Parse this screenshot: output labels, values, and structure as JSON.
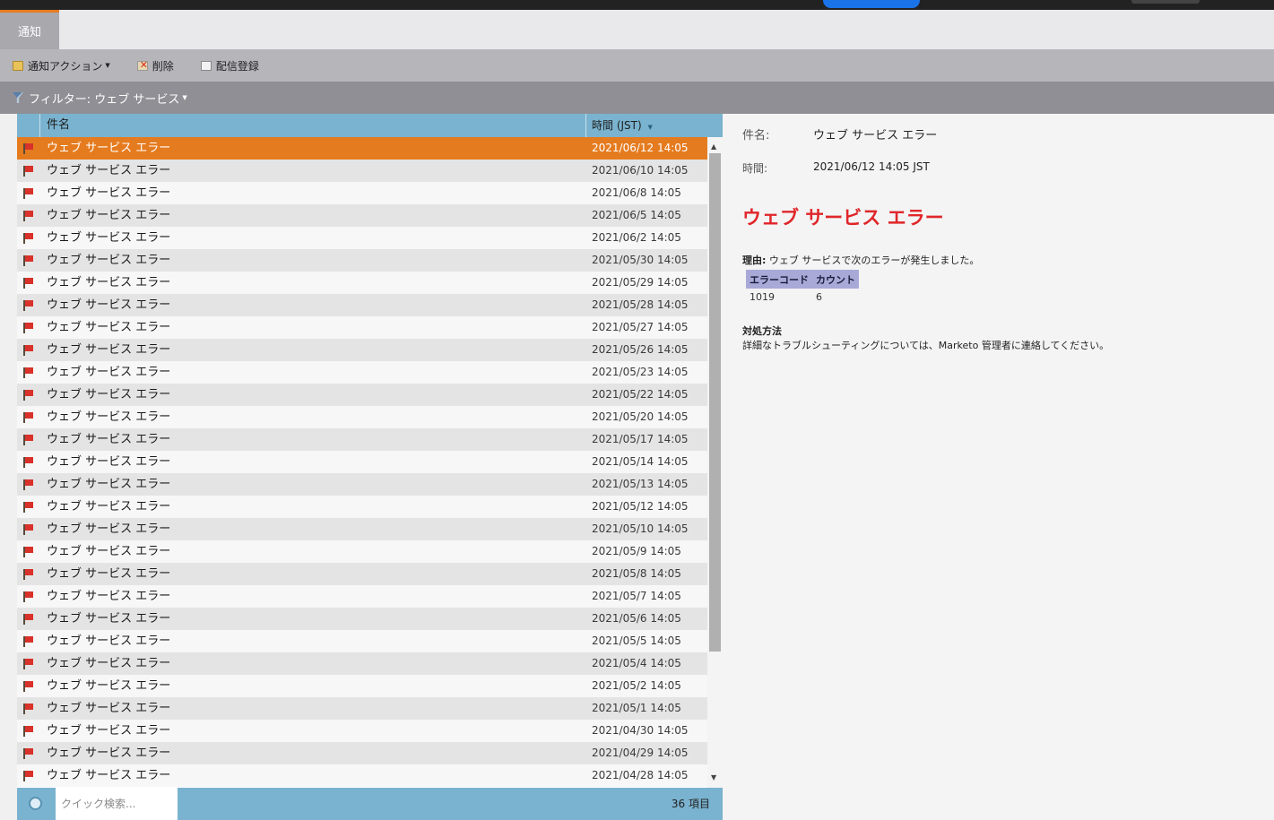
{
  "tab": {
    "label": "通知"
  },
  "toolbar": {
    "actions_label": "通知アクション",
    "delete_label": "削除",
    "subscribe_label": "配信登録"
  },
  "filter": {
    "label": "フィルター: ウェブ サービス"
  },
  "grid": {
    "columns": {
      "subject": "件名",
      "time": "時間 (JST)"
    },
    "rows": [
      {
        "subject": "ウェブ サービス エラー",
        "time": "2021/06/12 14:05",
        "selected": true
      },
      {
        "subject": "ウェブ サービス エラー",
        "time": "2021/06/10 14:05"
      },
      {
        "subject": "ウェブ サービス エラー",
        "time": "2021/06/8 14:05"
      },
      {
        "subject": "ウェブ サービス エラー",
        "time": "2021/06/5 14:05"
      },
      {
        "subject": "ウェブ サービス エラー",
        "time": "2021/06/2 14:05"
      },
      {
        "subject": "ウェブ サービス エラー",
        "time": "2021/05/30 14:05"
      },
      {
        "subject": "ウェブ サービス エラー",
        "time": "2021/05/29 14:05"
      },
      {
        "subject": "ウェブ サービス エラー",
        "time": "2021/05/28 14:05"
      },
      {
        "subject": "ウェブ サービス エラー",
        "time": "2021/05/27 14:05"
      },
      {
        "subject": "ウェブ サービス エラー",
        "time": "2021/05/26 14:05"
      },
      {
        "subject": "ウェブ サービス エラー",
        "time": "2021/05/23 14:05"
      },
      {
        "subject": "ウェブ サービス エラー",
        "time": "2021/05/22 14:05"
      },
      {
        "subject": "ウェブ サービス エラー",
        "time": "2021/05/20 14:05"
      },
      {
        "subject": "ウェブ サービス エラー",
        "time": "2021/05/17 14:05"
      },
      {
        "subject": "ウェブ サービス エラー",
        "time": "2021/05/14 14:05"
      },
      {
        "subject": "ウェブ サービス エラー",
        "time": "2021/05/13 14:05"
      },
      {
        "subject": "ウェブ サービス エラー",
        "time": "2021/05/12 14:05"
      },
      {
        "subject": "ウェブ サービス エラー",
        "time": "2021/05/10 14:05"
      },
      {
        "subject": "ウェブ サービス エラー",
        "time": "2021/05/9 14:05"
      },
      {
        "subject": "ウェブ サービス エラー",
        "time": "2021/05/8 14:05"
      },
      {
        "subject": "ウェブ サービス エラー",
        "time": "2021/05/7 14:05"
      },
      {
        "subject": "ウェブ サービス エラー",
        "time": "2021/05/6 14:05"
      },
      {
        "subject": "ウェブ サービス エラー",
        "time": "2021/05/5 14:05"
      },
      {
        "subject": "ウェブ サービス エラー",
        "time": "2021/05/4 14:05"
      },
      {
        "subject": "ウェブ サービス エラー",
        "time": "2021/05/2 14:05"
      },
      {
        "subject": "ウェブ サービス エラー",
        "time": "2021/05/1 14:05"
      },
      {
        "subject": "ウェブ サービス エラー",
        "time": "2021/04/30 14:05"
      },
      {
        "subject": "ウェブ サービス エラー",
        "time": "2021/04/29 14:05"
      },
      {
        "subject": "ウェブ サービス エラー",
        "time": "2021/04/28 14:05"
      }
    ],
    "search_placeholder": "クイック検索...",
    "count_label": "36 項目"
  },
  "detail": {
    "subject_label": "件名:",
    "subject_value": "ウェブ サービス エラー",
    "time_label": "時間:",
    "time_value": "2021/06/12 14:05 JST",
    "title": "ウェブ サービス エラー",
    "reason_label": "理由:",
    "reason_text": " ウェブ サービスで次のエラーが発生しました。",
    "error_table": {
      "headers": [
        "エラーコード",
        "カウント"
      ],
      "rows": [
        [
          "1019",
          "6"
        ]
      ]
    },
    "action_heading": "対処方法",
    "action_text": "詳細なトラブルシューティングについては、Marketo 管理者に連絡してください。"
  },
  "colors": {
    "accent_orange": "#e57b1f",
    "grid_header": "#7ab3cf",
    "error_red": "#e0262a",
    "table_header": "#a9a9d8"
  },
  "icons": [
    "folder-icon",
    "delete-icon",
    "mail-icon",
    "filter-icon",
    "flag-icon",
    "search-icon",
    "sort-desc-icon",
    "scroll-up-icon",
    "scroll-down-icon"
  ]
}
